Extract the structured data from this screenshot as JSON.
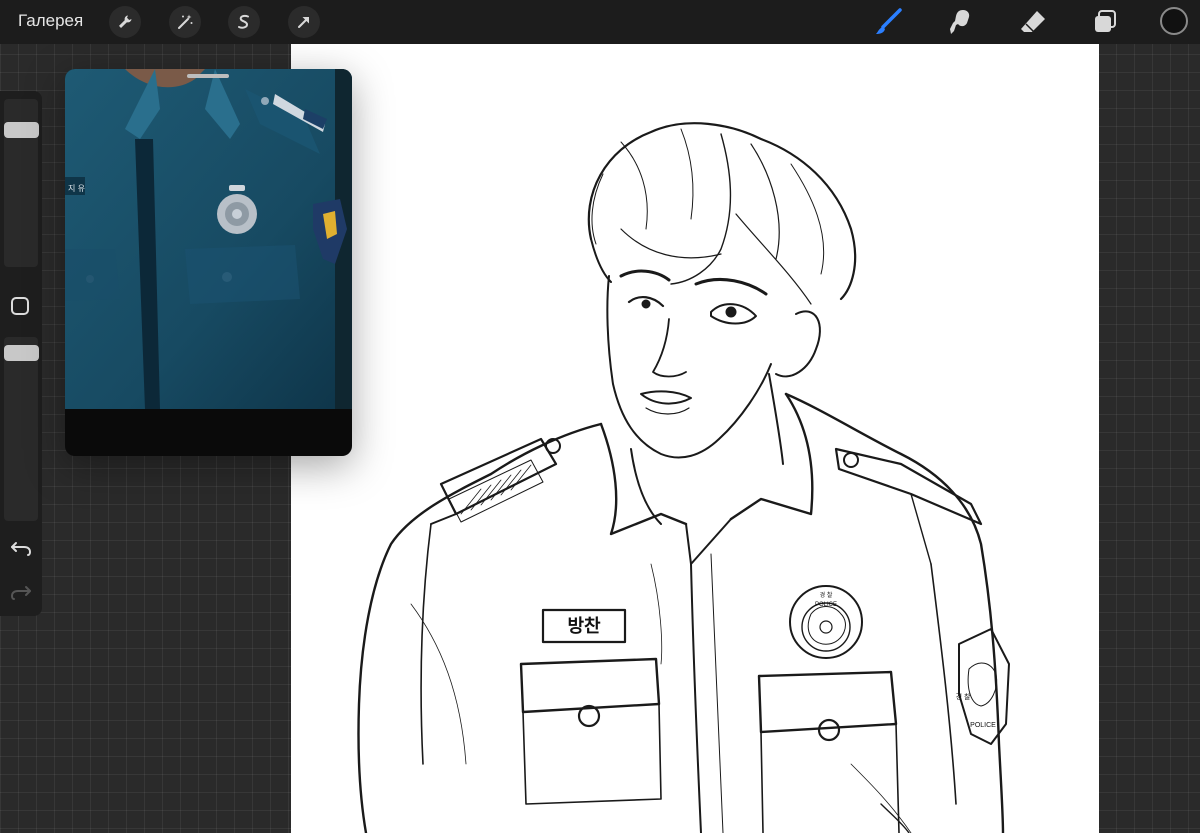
{
  "topbar": {
    "gallery_label": "Галерея",
    "left_tools": [
      {
        "name": "actions-wrench-icon"
      },
      {
        "name": "adjustments-magic-wand-icon"
      },
      {
        "name": "selection-s-icon"
      },
      {
        "name": "transform-arrow-icon"
      }
    ],
    "right_tools": [
      {
        "name": "brush-icon",
        "active": true,
        "color": "#2b7fff"
      },
      {
        "name": "smudge-icon"
      },
      {
        "name": "eraser-icon"
      },
      {
        "name": "layers-icon"
      }
    ],
    "current_color": "#111111"
  },
  "sidebar": {
    "size_slider_level": 0.15,
    "opacity_slider_level": 0.05,
    "icons": [
      "modify-square-icon",
      "undo-icon",
      "redo-icon"
    ]
  },
  "reference": {
    "label": "reference-photo",
    "nametag_text": "지 유"
  },
  "canvas": {
    "nametag_text": "방찬",
    "badge_text": "POLICE",
    "badge_top_text": "경 찰",
    "patch_text": "POLICE",
    "patch_side_text": "경 찰"
  }
}
